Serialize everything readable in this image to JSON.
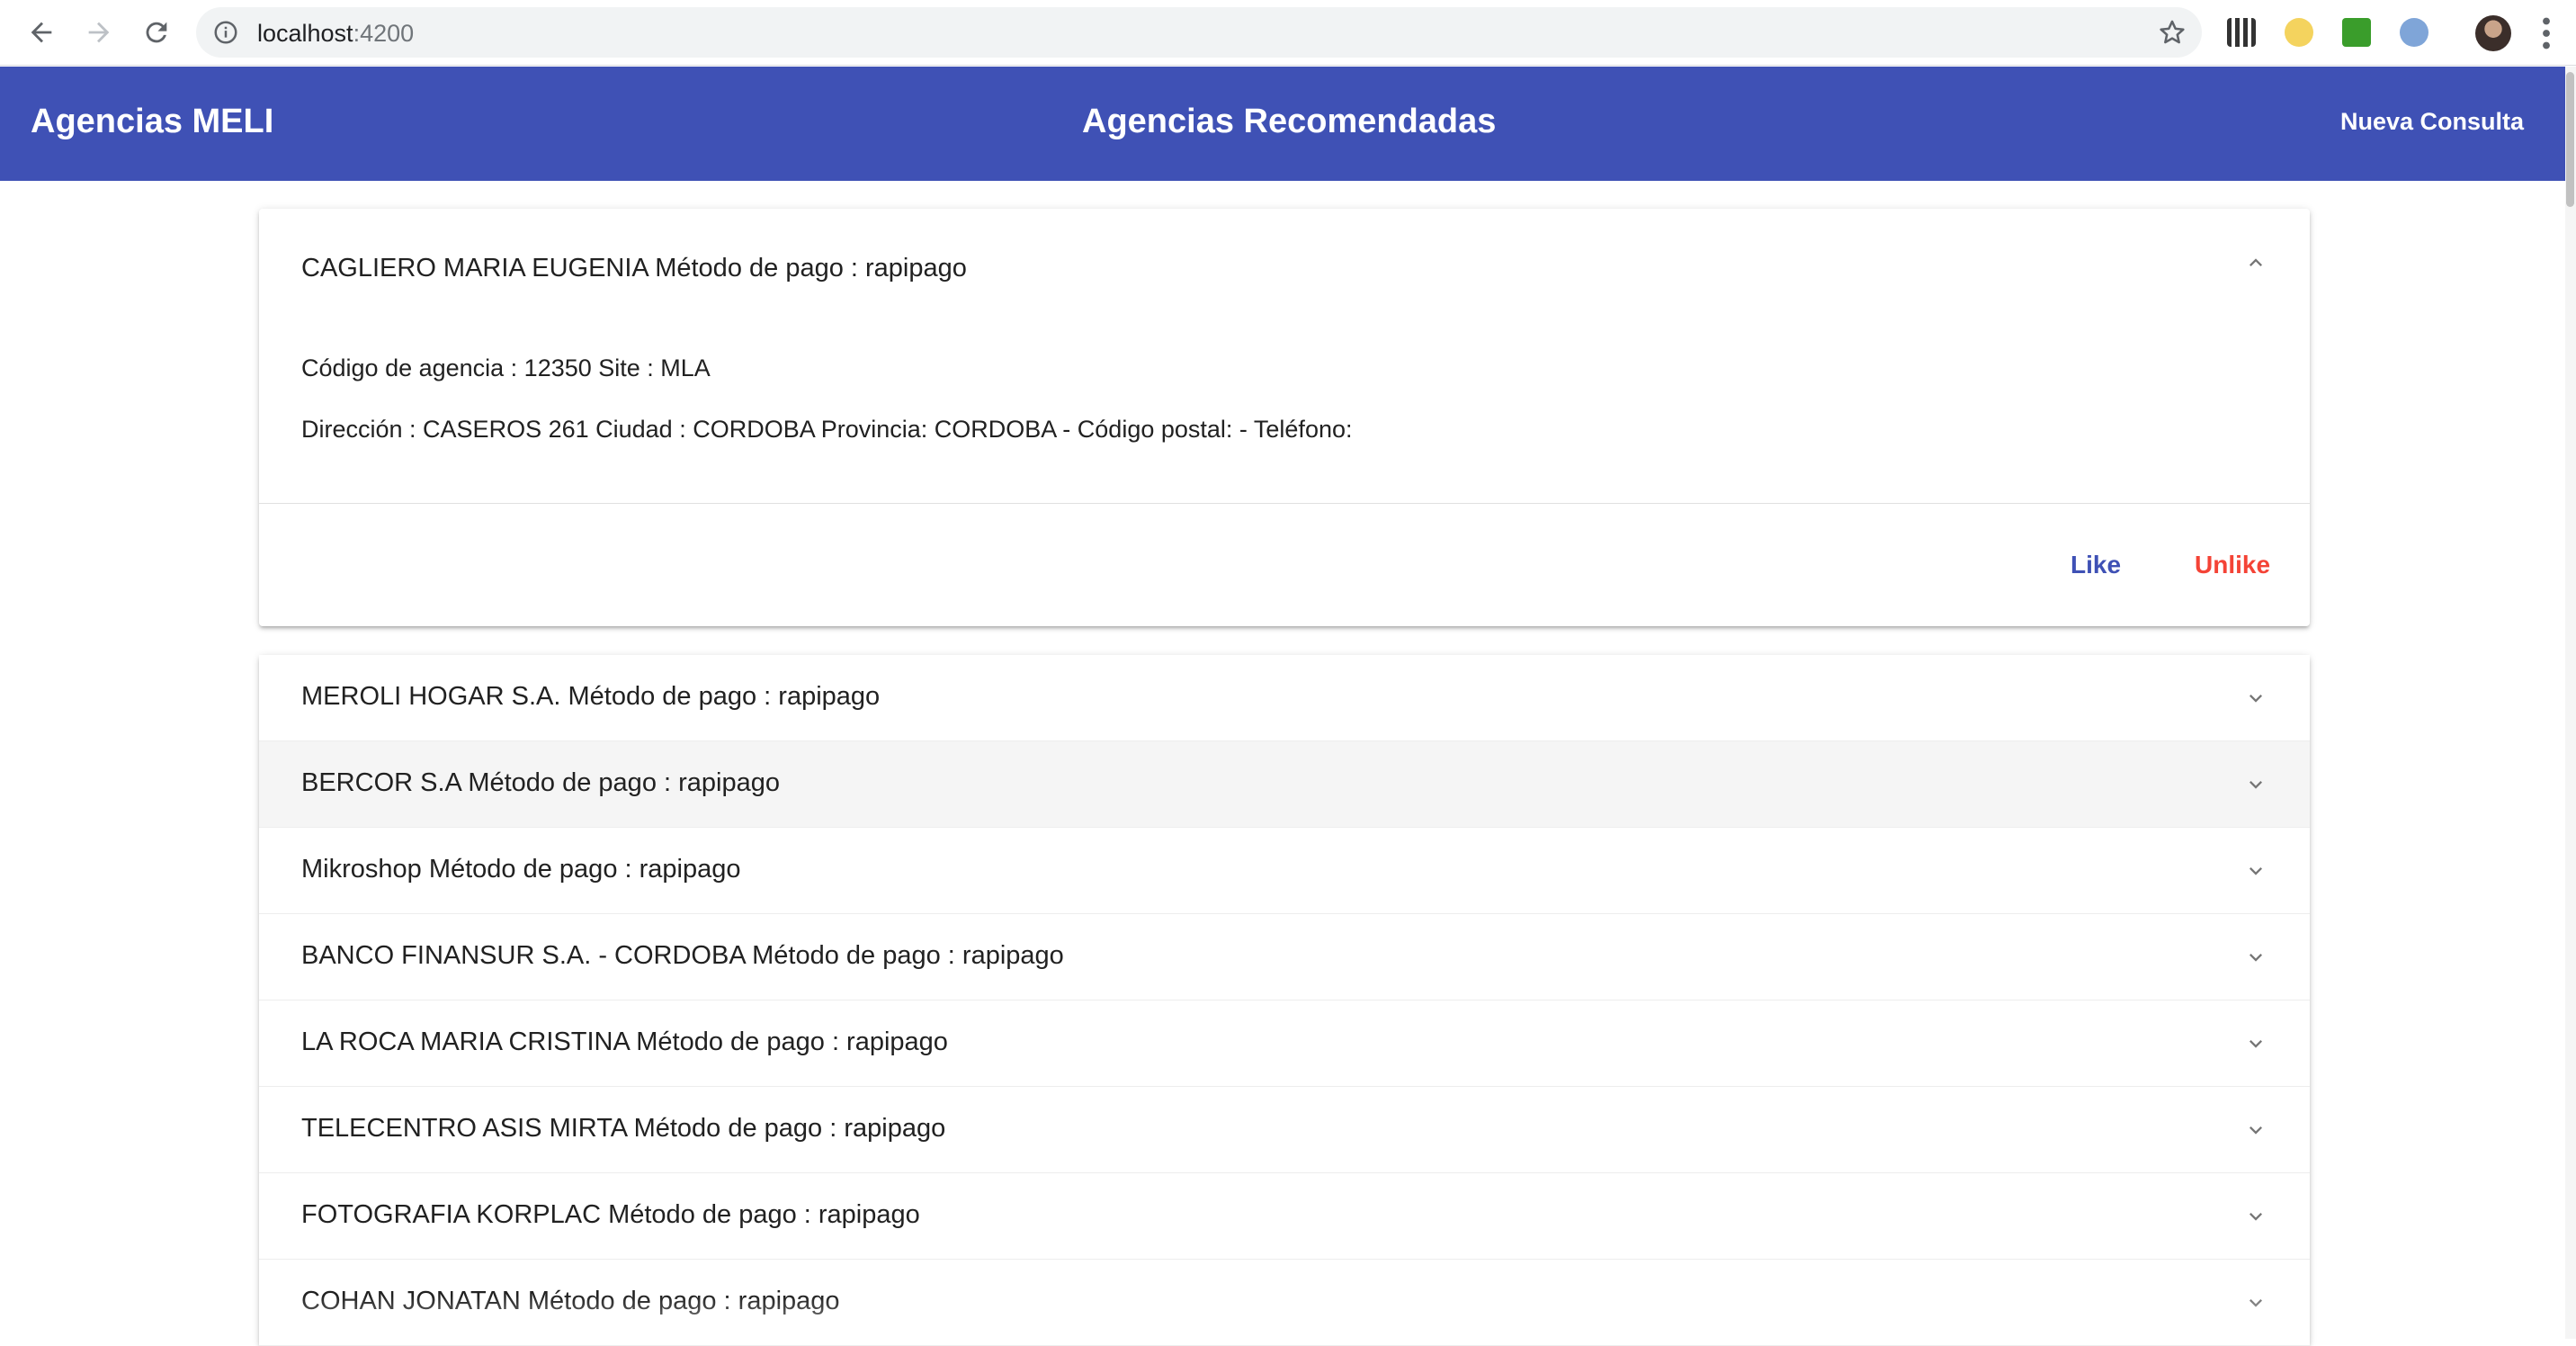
{
  "browser": {
    "url_host": "localhost",
    "url_port": ":4200"
  },
  "app": {
    "brand": "Agencias MELI",
    "page_title": "Agencias Recomendadas",
    "new_query_label": "Nueva Consulta",
    "accent_color": "#3f51b5",
    "unlike_color": "#f44336"
  },
  "expanded_agency": {
    "title": "CAGLIERO MARIA EUGENIA Método de pago : rapipago",
    "code_line": "Código de agencia : 12350 Site : MLA",
    "address_line": "Dirección : CASEROS 261 Ciudad : CORDOBA Provincia: CORDOBA - Código postal: - Teléfono:",
    "like_label": "Like",
    "unlike_label": "Unlike"
  },
  "agencies": [
    {
      "title": "MEROLI HOGAR S.A. Método de pago : rapipago"
    },
    {
      "title": "BERCOR S.A Método de pago : rapipago"
    },
    {
      "title": "Mikroshop Método de pago : rapipago"
    },
    {
      "title": "BANCO FINANSUR S.A. - CORDOBA Método de pago : rapipago"
    },
    {
      "title": "LA ROCA MARIA CRISTINA Método de pago : rapipago"
    },
    {
      "title": "TELECENTRO ASIS MIRTA Método de pago : rapipago"
    },
    {
      "title": "FOTOGRAFIA KORPLAC Método de pago : rapipago"
    },
    {
      "title": "COHAN JONATAN Método de pago : rapipago"
    }
  ]
}
